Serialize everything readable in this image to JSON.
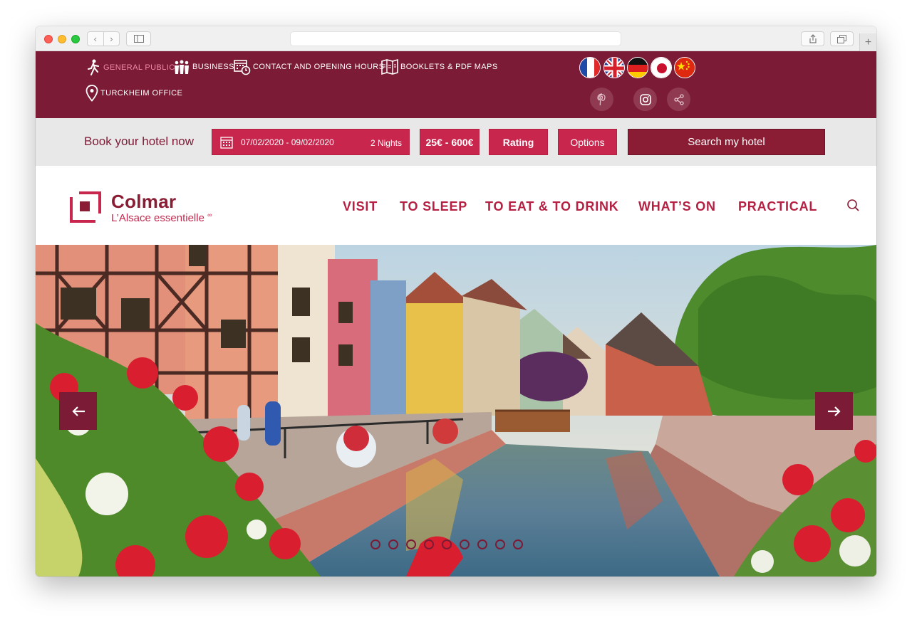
{
  "top_links": [
    {
      "label": "GENERAL PUBLIC",
      "icon": "walking-person-icon",
      "active": true
    },
    {
      "label": "BUSINESS",
      "icon": "group-icon",
      "active": false
    },
    {
      "label": "CONTACT AND OPENING HOURS",
      "icon": "calendar-clock-icon",
      "active": false
    },
    {
      "label": "BOOKLETS & PDF MAPS",
      "icon": "map-booklet-icon",
      "active": false
    },
    {
      "label": "TURCKHEIM OFFICE",
      "icon": "map-pin-icon",
      "active": false
    }
  ],
  "languages": [
    "french-flag-icon",
    "uk-flag-icon",
    "german-flag-icon",
    "japanese-flag-icon",
    "chinese-flag-icon"
  ],
  "social": [
    "pinterest-icon",
    "instagram-icon",
    "share-icon"
  ],
  "booking": {
    "title": "Book your hotel now",
    "dates": "07/02/2020 - 09/02/2020",
    "nights": "2 Nights",
    "price": "25€ - 600€",
    "rating": "Rating",
    "options": "Options",
    "search": "Search my hotel"
  },
  "brand": {
    "name": "Colmar",
    "tagline": "L’Alsace essentielle",
    "tagline_mark": "∞"
  },
  "nav": [
    "VISIT",
    "TO SLEEP",
    "TO EAT & TO DRINK",
    "WHAT’S ON",
    "PRACTICAL"
  ],
  "slider": {
    "slide_count": 9,
    "active_slide": 1
  },
  "colors": {
    "brand_dark": "#7b1b35",
    "brand_red": "#c8264d",
    "nav_red": "#b51f42"
  }
}
